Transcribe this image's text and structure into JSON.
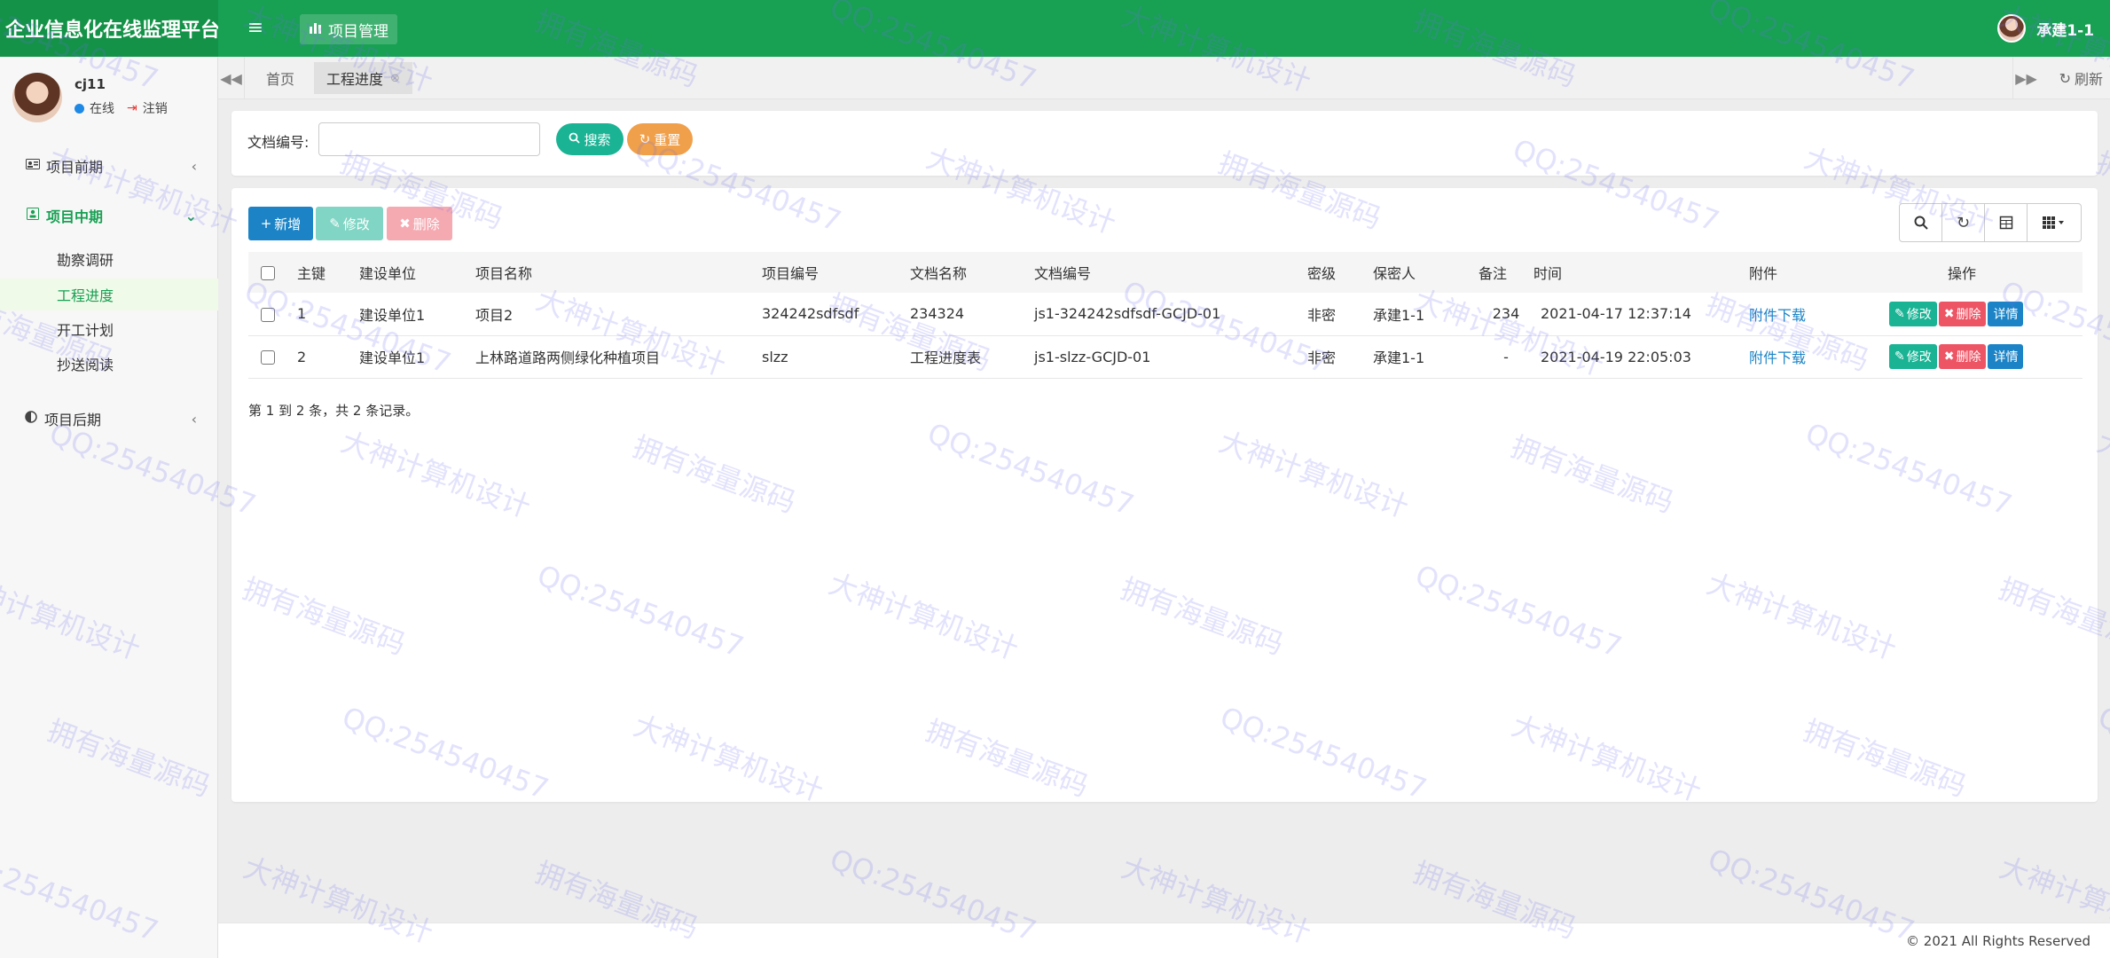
{
  "header": {
    "brand": "企业信息化在线监理平台",
    "menu_icon": "hamburger-icon",
    "module_tab": "项目管理",
    "user": "承建1-1"
  },
  "sidebar": {
    "username": "cj11",
    "status_online": "在线",
    "logout": "注销",
    "groups": [
      {
        "label": "项目前期",
        "icon": "id-card-icon"
      },
      {
        "label": "项目中期",
        "icon": "user-square-icon"
      },
      {
        "label": "项目后期",
        "icon": "half-circle-icon"
      }
    ],
    "subitems": [
      "勘察调研",
      "工程进度",
      "开工计划",
      "抄送阅读"
    ]
  },
  "tabs": {
    "home": "首页",
    "current": "工程进度",
    "refresh": "刷新"
  },
  "search": {
    "label": "文档编号:",
    "value": "",
    "search_btn": "搜索",
    "reset_btn": "重置"
  },
  "toolbar": {
    "add": "新增",
    "edit": "修改",
    "delete": "删除"
  },
  "table": {
    "headers": [
      "主键",
      "建设单位",
      "项目名称",
      "项目编号",
      "文档名称",
      "文档编号",
      "密级",
      "保密人",
      "备注",
      "时间",
      "附件",
      "操作"
    ],
    "rows": [
      {
        "id": "1",
        "unit": "建设单位1",
        "name": "项目2",
        "code": "324242sdfsdf",
        "doc_name": "234324",
        "doc_code": "js1-324242sdfsdf-GCJD-01",
        "level": "非密",
        "keeper": "承建1-1",
        "note": "234",
        "time": "2021-04-17 12:37:14",
        "attach": "附件下载"
      },
      {
        "id": "2",
        "unit": "建设单位1",
        "name": "上林路道路两侧绿化种植项目",
        "code": "slzz",
        "doc_name": "工程进度表",
        "doc_code": "js1-slzz-GCJD-01",
        "level": "非密",
        "keeper": "承建1-1",
        "note": "-",
        "time": "2021-04-19 22:05:03",
        "attach": "附件下载"
      }
    ],
    "op_edit": "修改",
    "op_delete": "删除",
    "op_detail": "详情",
    "summary": "第 1 到 2 条，共 2 条记录。"
  },
  "footer": {
    "copyright": "© 2021 All Rights Reserved"
  },
  "watermarks": [
    "QQ:254540457",
    "大神计算机设计",
    "拥有海量源码"
  ],
  "colors": {
    "primary_green": "#18a053",
    "teal": "#1ab394",
    "orange": "#f0a04b",
    "blue": "#1c84c6",
    "red": "#ed5565"
  }
}
